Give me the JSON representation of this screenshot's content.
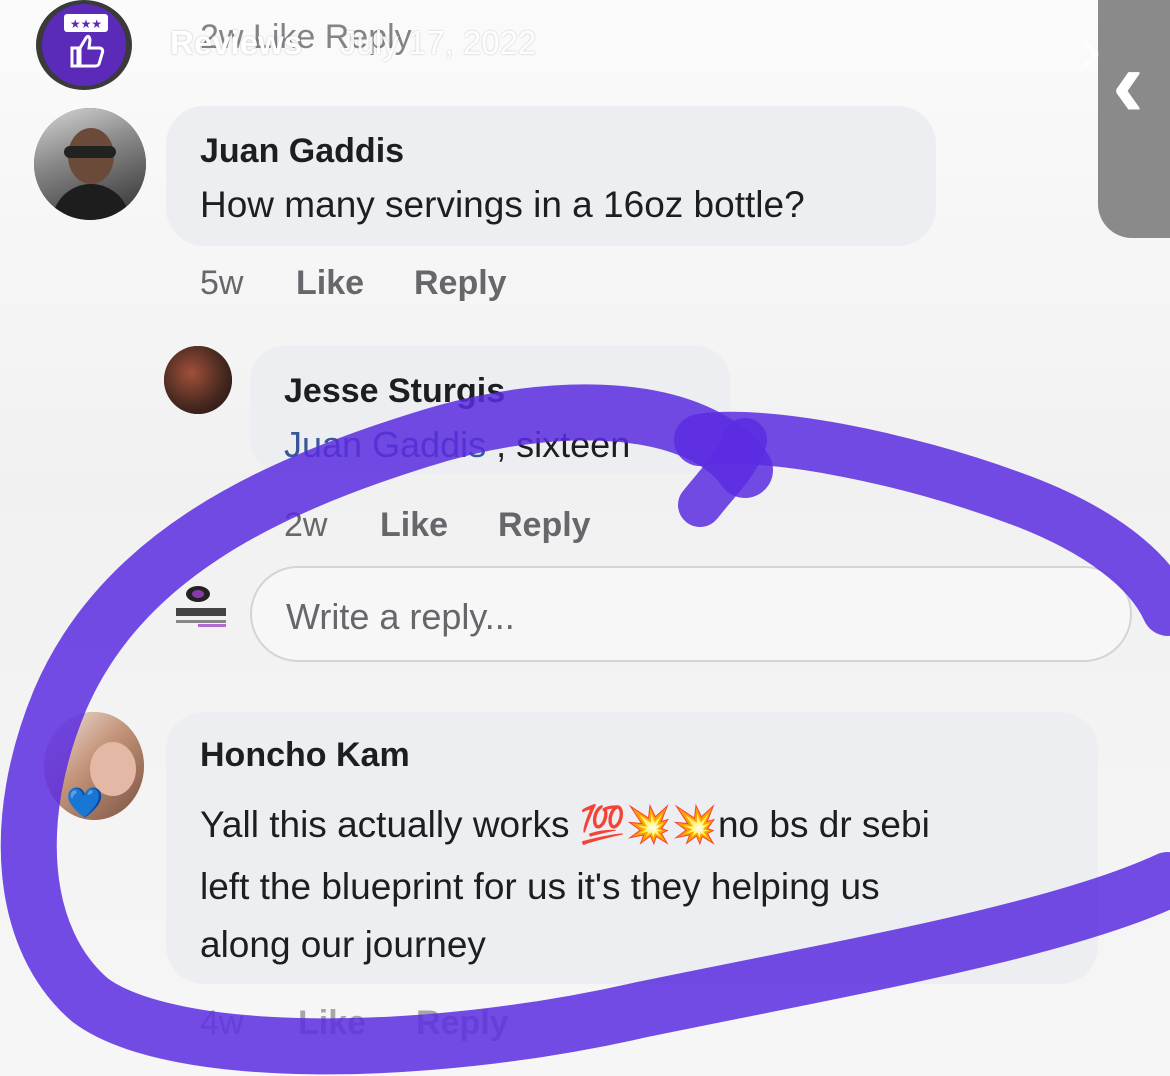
{
  "story_header": {
    "account_label": "Reviews",
    "date_label": "July 17, 2022",
    "underlying_actions": "2w Like Reply",
    "back_glyph": "‹"
  },
  "comments": [
    {
      "author": "Juan Gaddis",
      "text": "How many servings in a 16oz bottle?",
      "time": "5w",
      "like_label": "Like",
      "reply_label": "Reply",
      "avatar_icon": "profile-photo"
    },
    {
      "author": "Jesse Sturgis",
      "mention": "Juan Gaddis",
      "text_suffix": " , sixteen",
      "time": "2w",
      "like_label": "Like",
      "reply_label": "Reply",
      "avatar_icon": "profile-photo"
    },
    {
      "author": "Honcho Kam",
      "text_line1_part1": "Yall this actually works ",
      "text_line1_emoji": "💯💥💥",
      "text_line1_part2": "no bs dr sebi",
      "text_line2": "left the blueprint for us it's they helping us",
      "text_line3": "along our journey",
      "time": "4w",
      "like_label": "Like",
      "reply_label": "Reply",
      "avatar_badge": "💙"
    }
  ],
  "reply_box": {
    "placeholder": "Write a reply..."
  },
  "colors": {
    "bubble": "#eceef1",
    "mention": "#385898",
    "highlight_stroke": "#5b2be0",
    "meta_text": "#65676b"
  }
}
